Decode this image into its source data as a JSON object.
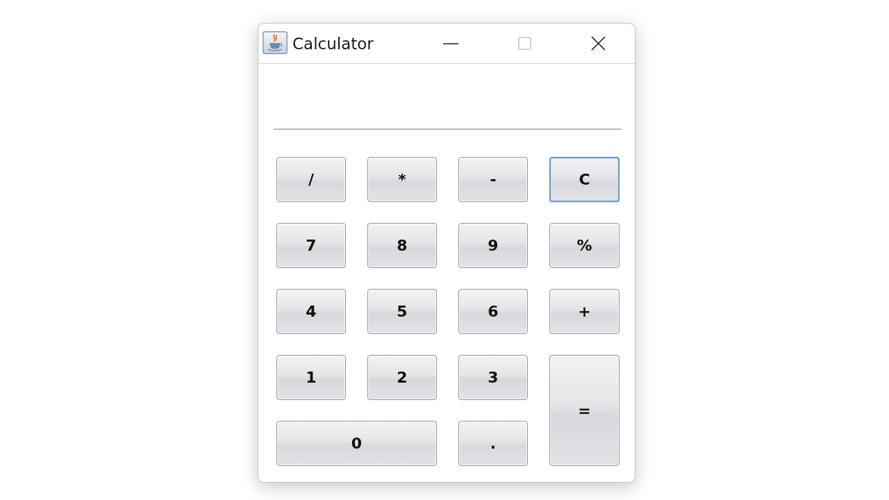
{
  "window": {
    "title": "Calculator",
    "controls": [
      {
        "kind": "minimize",
        "disabled": false
      },
      {
        "kind": "maximize",
        "disabled": true
      },
      {
        "kind": "close",
        "disabled": false
      }
    ]
  },
  "keys": [
    {
      "label": "/",
      "kind": "normal",
      "focused": false
    },
    {
      "label": "*",
      "kind": "normal",
      "focused": false
    },
    {
      "label": "-",
      "kind": "normal",
      "focused": false
    },
    {
      "label": "C",
      "kind": "normal",
      "focused": true
    },
    {
      "label": "7",
      "kind": "normal",
      "focused": false
    },
    {
      "label": "8",
      "kind": "normal",
      "focused": false
    },
    {
      "label": "9",
      "kind": "normal",
      "focused": false
    },
    {
      "label": "%",
      "kind": "normal",
      "focused": false
    },
    {
      "label": "4",
      "kind": "normal",
      "focused": false
    },
    {
      "label": "5",
      "kind": "normal",
      "focused": false
    },
    {
      "label": "6",
      "kind": "normal",
      "focused": false
    },
    {
      "label": "+",
      "kind": "normal",
      "focused": false
    },
    {
      "label": "1",
      "kind": "normal",
      "focused": false
    },
    {
      "label": "2",
      "kind": "normal",
      "focused": false
    },
    {
      "label": "3",
      "kind": "normal",
      "focused": false
    },
    {
      "label": "=",
      "kind": "tall",
      "focused": false
    },
    {
      "label": "0",
      "kind": "wide",
      "focused": false
    },
    {
      "label": ".",
      "kind": "normal",
      "focused": false
    }
  ]
}
